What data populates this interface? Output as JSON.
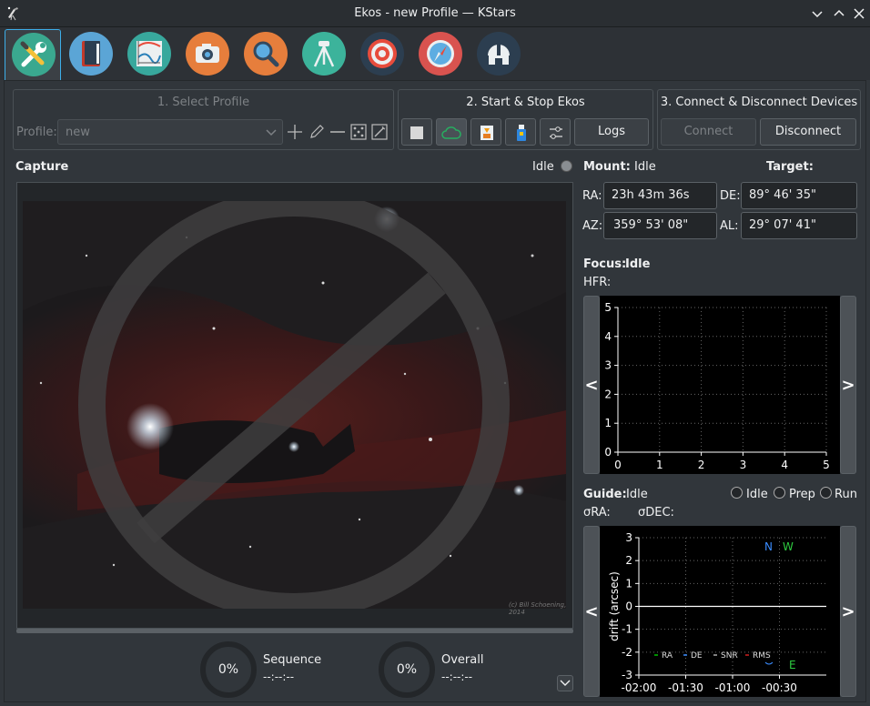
{
  "window": {
    "title": "Ekos - new Profile — KStars",
    "controls": [
      "minimize-icon",
      "maximize-icon",
      "close-icon"
    ]
  },
  "tabs": [
    {
      "name": "setup",
      "icon": "wrench-screwdriver-icon",
      "color": "#3aa88f",
      "active": true
    },
    {
      "name": "scheduler",
      "icon": "book-icon",
      "color": "#5ba5d6"
    },
    {
      "name": "analyze",
      "icon": "chart-icon",
      "color": "#38a89d"
    },
    {
      "name": "capture",
      "icon": "camera-icon",
      "color": "#e67e3c"
    },
    {
      "name": "focus",
      "icon": "magnifier-icon",
      "color": "#e67e3c"
    },
    {
      "name": "mount",
      "icon": "tripod-icon",
      "color": "#3cb39b"
    },
    {
      "name": "align",
      "icon": "target-icon",
      "color": "#d9534f"
    },
    {
      "name": "guide",
      "icon": "compass-icon",
      "color": "#d9534f"
    },
    {
      "name": "observatory",
      "icon": "dome-icon",
      "color": "#2c3e50"
    }
  ],
  "profile_group": {
    "title": "1. Select Profile",
    "profile_label": "Profile:",
    "profile_value": "new"
  },
  "start_group": {
    "title": "2. Start & Stop Ekos",
    "logs_label": "Logs"
  },
  "connect_group": {
    "title": "3. Connect & Disconnect Devices",
    "connect_label": "Connect",
    "disconnect_label": "Disconnect"
  },
  "capture": {
    "title": "Capture",
    "status": "Idle",
    "watermark": "(c) Bill Schoening, 2014",
    "sequence_label": "Sequence",
    "sequence_percent": "0%",
    "sequence_time": "--:--:--",
    "overall_label": "Overall",
    "overall_percent": "0%",
    "overall_time": "--:--:--"
  },
  "mount": {
    "label": "Mount:",
    "status": "Idle",
    "target_label": "Target:",
    "ra_label": "RA:",
    "ra_value": "23h 43m 36s",
    "de_label": "DE:",
    "de_value": "89° 46' 35\"",
    "az_label": "AZ:",
    "az_value": "359° 53' 08\"",
    "al_label": "AL:",
    "al_value": "29° 07' 41\""
  },
  "focus": {
    "label": "Focus:",
    "status": "Idle",
    "hfr_label": "HFR:",
    "prev": "<",
    "next": ">"
  },
  "guide": {
    "label": "Guide:",
    "status": "Idle",
    "radio_idle": "Idle",
    "radio_prep": "Prep",
    "radio_run": "Run",
    "sigma_ra": "σRA:",
    "sigma_dec": "σDEC:",
    "prev": "<",
    "next": ">",
    "compass_n": "N",
    "compass_w": "W",
    "compass_e": "E",
    "legend_ra": "RA",
    "legend_de": "DE",
    "legend_snr": "SNR",
    "legend_rms": "RMS",
    "colors": {
      "ra": "#00c000",
      "de": "#3a8cff",
      "snr": "#aaaaaa",
      "rms": "#d02020"
    }
  },
  "chart_data": [
    {
      "type": "scatter",
      "name": "focus-hfr",
      "x_ticks": [
        "0",
        "1",
        "2",
        "3",
        "4",
        "5"
      ],
      "y_ticks": [
        "0",
        "1",
        "2",
        "3",
        "4",
        "5"
      ],
      "xlim": [
        0,
        5
      ],
      "ylim": [
        0,
        5
      ],
      "grid": true,
      "series": []
    },
    {
      "type": "line",
      "name": "guide-drift",
      "ylabel": "drift (arcsec)",
      "x_ticks": [
        "-02:00",
        "-01:30",
        "-01:00",
        "-00:30"
      ],
      "y_ticks": [
        "3",
        "2",
        "1",
        "0",
        "-1",
        "-2",
        "-3"
      ],
      "ylim": [
        -3,
        3
      ],
      "grid": true,
      "series": []
    }
  ]
}
